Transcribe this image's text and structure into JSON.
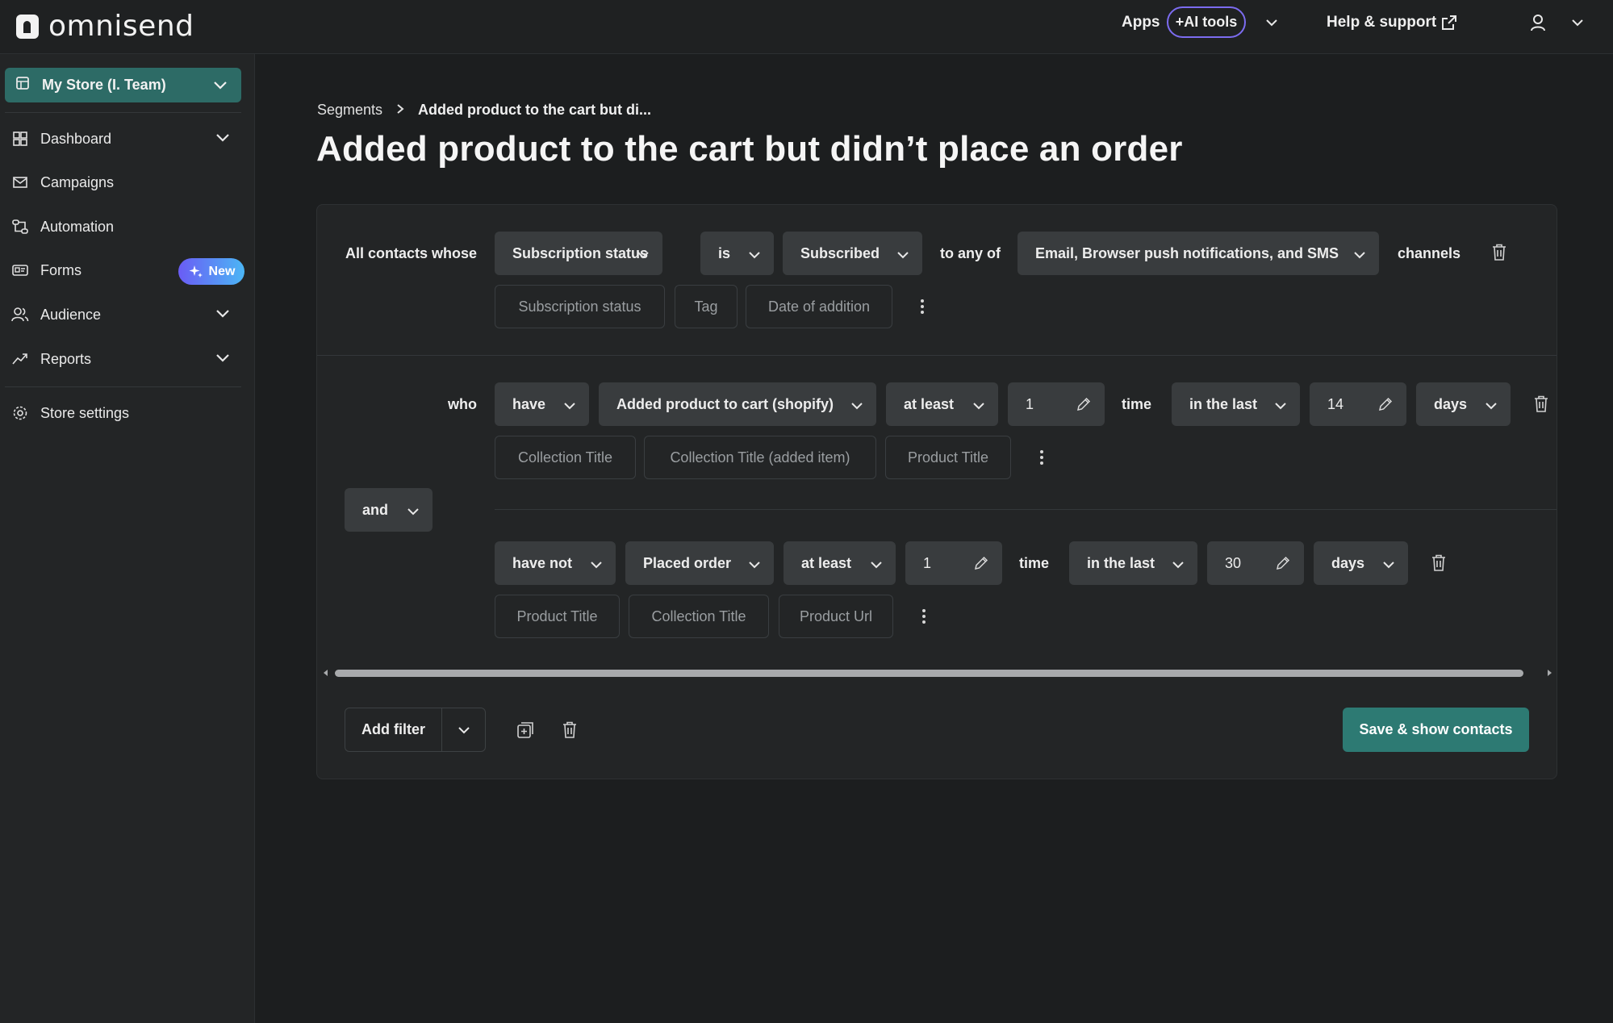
{
  "brand": {
    "name": "omnisend"
  },
  "topbar": {
    "apps_label": "Apps",
    "ai_tools_label": "+AI tools",
    "help_label": "Help & support"
  },
  "sidebar": {
    "store_label": "My Store (I. Team)",
    "items": [
      {
        "label": "Dashboard",
        "icon": "dashboard-icon"
      },
      {
        "label": "Campaigns",
        "icon": "mail-icon"
      },
      {
        "label": "Automation",
        "icon": "automation-icon"
      },
      {
        "label": "Forms",
        "icon": "forms-icon",
        "badge": "New"
      },
      {
        "label": "Audience",
        "icon": "audience-icon"
      },
      {
        "label": "Reports",
        "icon": "reports-icon"
      }
    ],
    "settings_label": "Store settings"
  },
  "breadcrumb": {
    "root": "Segments",
    "current": "Added product to the cart but di..."
  },
  "page_title": "Added product to the cart but didn’t place an order",
  "filter1": {
    "prefix": "All contacts whose",
    "field": "Subscription status",
    "operator": "is",
    "value": "Subscribed",
    "to_any_of": "to any of",
    "channels_value": "Email, Browser push notifications, and SMS",
    "suffix": "channels",
    "chips": [
      "Subscription status",
      "Tag",
      "Date of addition"
    ]
  },
  "filter2": {
    "prefix": "who",
    "verb": "have",
    "event": "Added product to cart (shopify)",
    "frequency": "at least",
    "count": "1",
    "time_label": "time",
    "range": "in the last",
    "range_value": "14",
    "unit": "days",
    "chips": [
      "Collection Title",
      "Collection Title (added item)",
      "Product Title"
    ]
  },
  "logic": {
    "joiner": "and"
  },
  "filter3": {
    "verb": "have not",
    "event": "Placed order",
    "frequency": "at least",
    "count": "1",
    "time_label": "time",
    "range": "in the last",
    "range_value": "30",
    "unit": "days",
    "chips": [
      "Product Title",
      "Collection Title",
      "Product Url"
    ]
  },
  "footer": {
    "add_filter_label": "Add filter",
    "save_label": "Save & show contacts"
  },
  "colors": {
    "accent": "#2d7a73",
    "store_button": "#2d6b66",
    "ai_border": "#7c6cf0",
    "badge_gradient_start": "#6a5cf5",
    "badge_gradient_end": "#4bb6f5"
  }
}
